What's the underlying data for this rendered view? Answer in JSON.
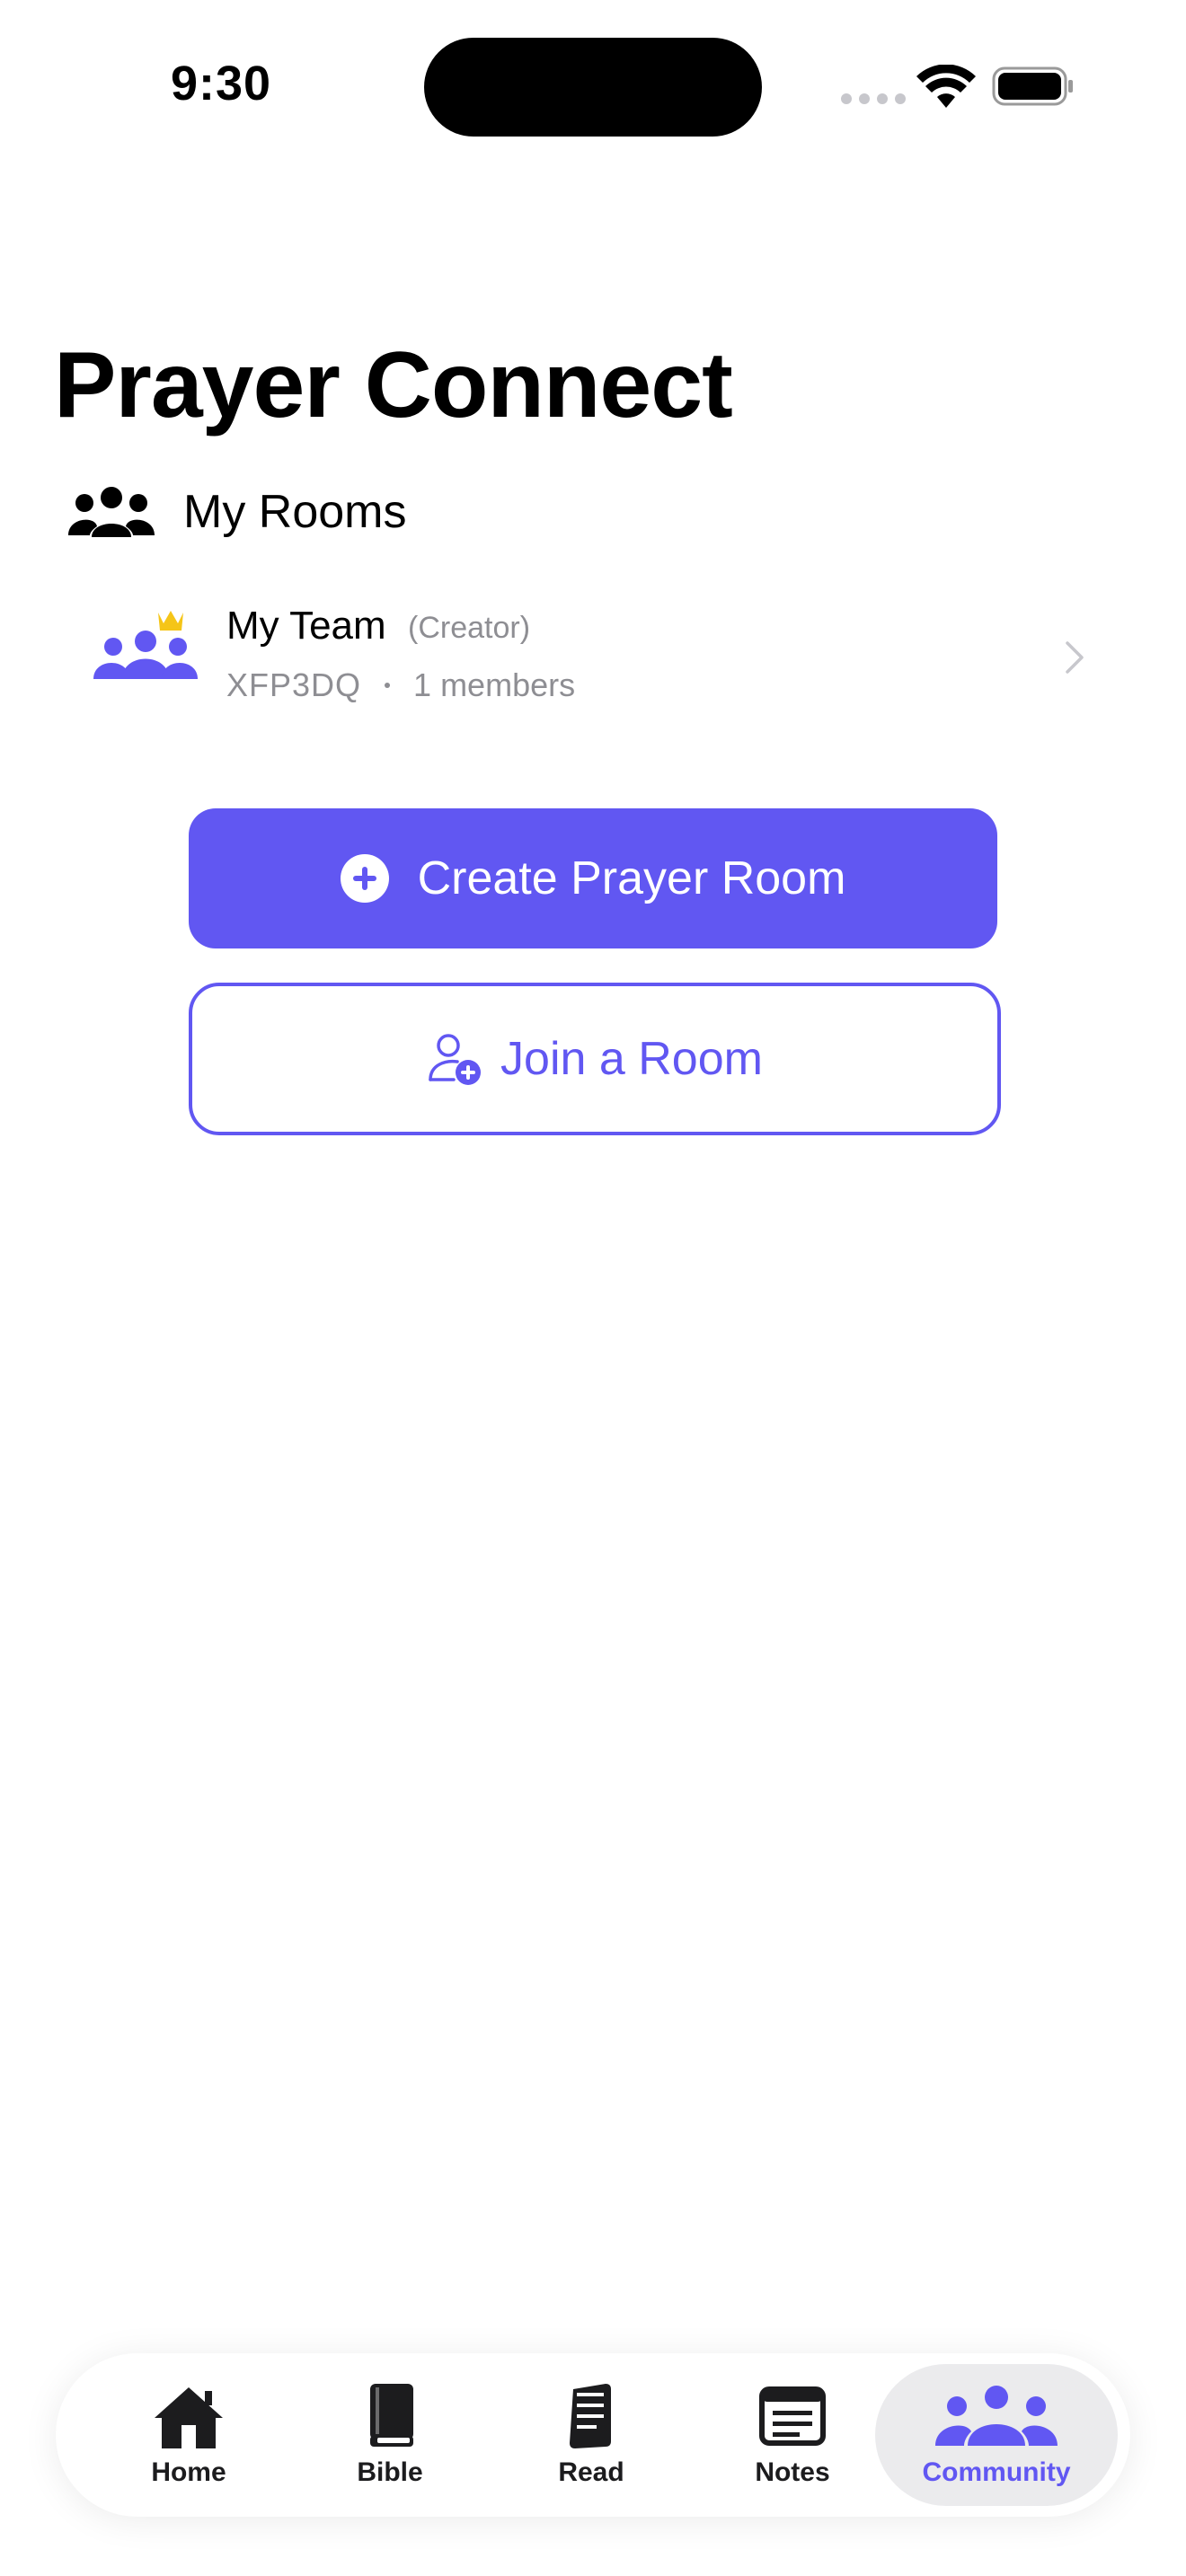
{
  "status_bar": {
    "time": "9:30"
  },
  "header": {
    "title": "Prayer Connect"
  },
  "rooms_section": {
    "label": "My Rooms"
  },
  "rooms": [
    {
      "name": "My Team",
      "role": "(Creator)",
      "code": "XFP3DQ",
      "members": "1 members"
    }
  ],
  "actions": {
    "create_label": "Create Prayer Room",
    "join_label": "Join a Room"
  },
  "tabs": [
    {
      "label": "Home",
      "icon": "home-icon"
    },
    {
      "label": "Bible",
      "icon": "book-icon"
    },
    {
      "label": "Read",
      "icon": "read-icon"
    },
    {
      "label": "Notes",
      "icon": "notes-icon"
    },
    {
      "label": "Community",
      "icon": "community-icon",
      "active": true
    }
  ],
  "colors": {
    "accent": "#6157f2",
    "crown": "#f5c518"
  }
}
